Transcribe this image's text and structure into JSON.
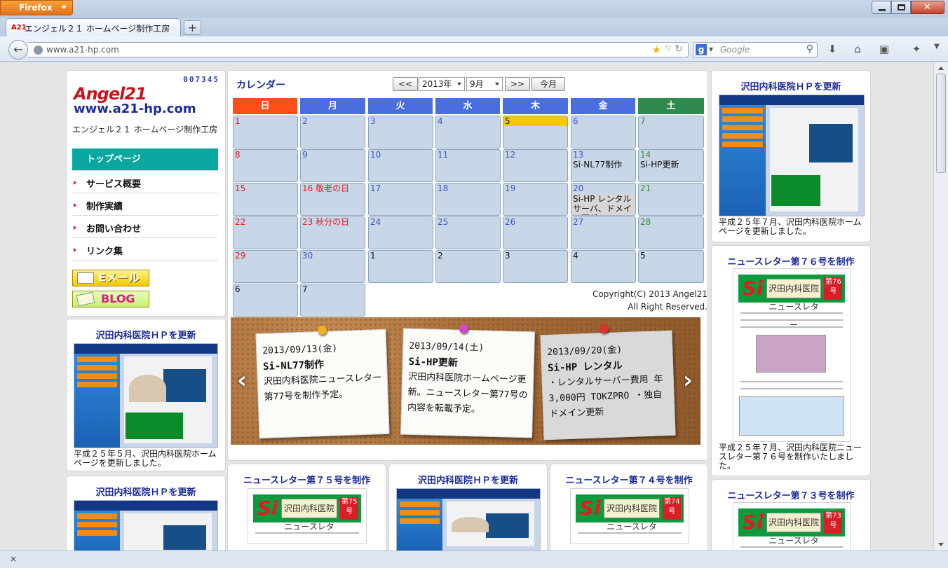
{
  "browser": {
    "app_button": "Firefox",
    "tab_title": "エンジェル２１ ホームページ制作工房",
    "tab_favicon": "A21",
    "new_tab": "+",
    "url": "www.a21-hp.com",
    "search_engine": "g",
    "search_placeholder": "Google",
    "close_x": "×",
    "icons": [
      "back-arrow-icon",
      "bookmark-star-icon",
      "reload-icon",
      "search-icon",
      "download-icon",
      "home-icon",
      "bookmarks-icon",
      "addon-icon",
      "menu-icon"
    ]
  },
  "sidebar": {
    "counter": "007345",
    "logo_line1": "Angel21",
    "logo_line2": "www.a21-hp.com",
    "site_name": "エンジェル２１ ホームページ制作工房",
    "menu": [
      {
        "label": "トップページ"
      },
      {
        "label": "サービス概要"
      },
      {
        "label": "制作実績"
      },
      {
        "label": "お問い合わせ"
      },
      {
        "label": "リンク集"
      }
    ],
    "mail_label": "Eメール",
    "blog_label": "BLOG"
  },
  "calendar": {
    "title": "カレンダー",
    "prev": "<<",
    "next": ">>",
    "year": "2013年",
    "month": "9月",
    "today_btn": "今月",
    "weekdays": [
      "日",
      "月",
      "火",
      "水",
      "木",
      "金",
      "土"
    ],
    "weekday_colors": [
      "#ff4e1a",
      "#4a6ee0",
      "#4a6ee0",
      "#4a6ee0",
      "#4a6ee0",
      "#4a6ee0",
      "#2f8a4e"
    ],
    "cells": [
      {
        "d": "1",
        "ev": ""
      },
      {
        "d": "2",
        "ev": ""
      },
      {
        "d": "3",
        "ev": ""
      },
      {
        "d": "4",
        "ev": ""
      },
      {
        "d": "5",
        "ev": ""
      },
      {
        "d": "6",
        "ev": ""
      },
      {
        "d": "7",
        "ev": ""
      },
      {
        "d": "8",
        "ev": ""
      },
      {
        "d": "9",
        "ev": ""
      },
      {
        "d": "10",
        "ev": ""
      },
      {
        "d": "11",
        "ev": ""
      },
      {
        "d": "12",
        "ev": ""
      },
      {
        "d": "13",
        "ev": "Si-NL77制作"
      },
      {
        "d": "14",
        "ev": "Si-HP更新"
      },
      {
        "d": "15",
        "ev": ""
      },
      {
        "d": "16 敬老の日",
        "ev": ""
      },
      {
        "d": "17",
        "ev": ""
      },
      {
        "d": "18",
        "ev": ""
      },
      {
        "d": "19",
        "ev": ""
      },
      {
        "d": "20",
        "ev": "Si-HP レンタルサーバ、ドメイン更新"
      },
      {
        "d": "21",
        "ev": ""
      },
      {
        "d": "22",
        "ev": ""
      },
      {
        "d": "23 秋分の日",
        "ev": ""
      },
      {
        "d": "24",
        "ev": ""
      },
      {
        "d": "25",
        "ev": ""
      },
      {
        "d": "26",
        "ev": ""
      },
      {
        "d": "27",
        "ev": ""
      },
      {
        "d": "28",
        "ev": ""
      },
      {
        "d": "29",
        "ev": ""
      },
      {
        "d": "30",
        "ev": ""
      },
      {
        "d": "1",
        "ev": ""
      },
      {
        "d": "2",
        "ev": ""
      },
      {
        "d": "3",
        "ev": ""
      },
      {
        "d": "4",
        "ev": ""
      },
      {
        "d": "5",
        "ev": ""
      },
      {
        "d": "6",
        "ev": ""
      },
      {
        "d": "7",
        "ev": ""
      }
    ],
    "copyright_line1": "Copyright(C) 2013 Angel21",
    "copyright_line2": "All Right Reserved."
  },
  "notes": [
    {
      "date": "2013/09/13(金)",
      "title": "Si-NL77制作",
      "body": "沢田内科医院ニュースレター第77号を制作予定。"
    },
    {
      "date": "2013/09/14(土)",
      "title": "Si-HP更新",
      "body": "沢田内科医院ホームページ更新。ニュースレター第77号の内容を転載予定。"
    },
    {
      "date": "2013/09/20(金)",
      "title": "Si-HP レンタル",
      "body": "・レンタルサーバー費用 年3,000円 TOKZPRO ・独自ドメイン更新"
    }
  ],
  "slider": {
    "prev": "‹",
    "next": "›"
  },
  "cards": {
    "left1": {
      "title": "沢田内科医院ＨＰを更新",
      "desc": "平成２５年５月、沢田内科医院ホームページを更新しました。"
    },
    "left2": {
      "title": "沢田内科医院ＨＰを更新"
    },
    "right1": {
      "title": "沢田内科医院ＨＰを更新",
      "desc": "平成２５年７月、沢田内科医院ホームページを更新しました。"
    },
    "right2": {
      "title": "ニュースレター第７６号を制作",
      "desc": "平成２５年７月、沢田内科医院ニュースレター第７６号を制作いたしました。"
    },
    "right3": {
      "title": "ニュースレター第７３号を制作"
    },
    "bottom1": {
      "title": "ニュースレター第７５号を制作"
    },
    "bottom2": {
      "title": "沢田内科医院ＨＰを更新"
    },
    "bottom3": {
      "title": "ニュースレター第７４号を制作"
    }
  },
  "newsletter": {
    "masthead": "沢田内科医院 ニュースレター",
    "mark": "Si",
    "issues": {
      "n73": "第73号",
      "n74": "第74号",
      "n75": "第75号",
      "n76": "第76号"
    }
  },
  "colors": {
    "accent": "#0aa6a0",
    "title_blue": "#1b2a9a",
    "logo_red": "#c4161c"
  }
}
